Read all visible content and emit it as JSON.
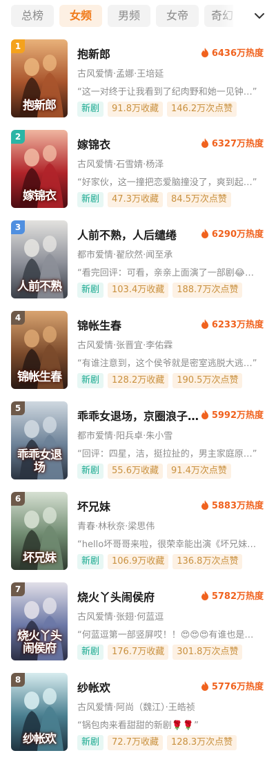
{
  "tabs": [
    {
      "label": "总榜",
      "active": false
    },
    {
      "label": "女频",
      "active": true
    },
    {
      "label": "男频",
      "active": false
    },
    {
      "label": "女帝",
      "active": false
    },
    {
      "label": "奇幻",
      "active": false
    }
  ],
  "expand_icon": "chevron-down-icon",
  "colors": {
    "accent": "#f07a1a",
    "heat": "#f0621e",
    "new_tag": "#17a88e",
    "stat_tag": "#c9913f"
  },
  "items": [
    {
      "rank": "1",
      "title": "抱新郎",
      "heat": "6436万热度",
      "meta": "古风爱情·孟娜·王培延",
      "quote": "“这一对终于让我看到了纪肉野和她一见钟…”",
      "tag": "新剧",
      "fav": "91.8万收藏",
      "likes": "146.2万次点赞",
      "cover_text": "抱新郎",
      "rank_color": "#f4a21d"
    },
    {
      "rank": "2",
      "title": "嫁锦衣",
      "heat": "6327万热度",
      "meta": "古风爱情·石雪婧·杨泽",
      "quote": "“好家伙，这一撞把恋爱脑撞没了，爽到起…”",
      "tag": "新剧",
      "fav": "47.3万收藏",
      "likes": "84.5万次点赞",
      "cover_text": "嫁锦衣",
      "rank_color": "#2bb5a5"
    },
    {
      "rank": "3",
      "title": "人前不熟，人后缱绻",
      "heat": "6290万热度",
      "meta": "都市爱情·翟欣然·闻至承",
      "quote": "“看完回评：可看，亲亲上面演了一部剧😂…”",
      "tag": "新剧",
      "fav": "103.4万收藏",
      "likes": "188.7万次点赞",
      "cover_text": "人前不熟",
      "rank_color": "#4f8fe0"
    },
    {
      "rank": "4",
      "title": "锦帐生春",
      "heat": "6233万热度",
      "meta": "古风爱情·张晋宜·李佑霖",
      "quote": "“有谁注意到，这个侯爷就是密室逃脱大逃…”",
      "tag": "新剧",
      "fav": "128.2万收藏",
      "likes": "190.5万次点赞",
      "cover_text": "锦帐生春",
      "rank_color": "#6e5a4a"
    },
    {
      "rank": "5",
      "title": "乖乖女退场，京圈浪子…",
      "heat": "5992万热度",
      "meta": "都市爱情·阳兵卓·朱小雪",
      "quote": "“回评：四星，洁，挺拉扯的，男主家庭原…”",
      "tag": "新剧",
      "fav": "55.6万收藏",
      "likes": "91.4万次点赞",
      "cover_text": "乖乖女退场",
      "rank_color": "#6e5a4a"
    },
    {
      "rank": "6",
      "title": "坏兄妹",
      "heat": "5883万热度",
      "meta": "青春·林秋奈·梁思伟",
      "quote": "“hello坏哥哥来啦，很荣幸能出演《坏兄妹》…”",
      "tag": "新剧",
      "fav": "106.9万收藏",
      "likes": "136.8万次点赞",
      "cover_text": "坏兄妹",
      "rank_color": "#6e5a4a"
    },
    {
      "rank": "7",
      "title": "烧火丫头闹侯府",
      "heat": "5782万热度",
      "meta": "古风爱情·张翅·何蓝逗",
      "quote": "“何蓝逗第一部竖屏哎！！😍😍😍有谁也是一…”",
      "tag": "新剧",
      "fav": "176.7万收藏",
      "likes": "301.8万次点赞",
      "cover_text": "烧火丫头闹侯府",
      "rank_color": "#6e5a4a"
    },
    {
      "rank": "8",
      "title": "纱帐欢",
      "heat": "5776万热度",
      "meta": "古风爱情·阿尚（魏江）·王皓祯",
      "quote": "“锅包肉来看甜甜的新剧🌹🌹”",
      "tag": "新剧",
      "fav": "72.7万收藏",
      "likes": "128.3万次点赞",
      "cover_text": "纱帐欢",
      "rank_color": "#6e5a4a"
    }
  ]
}
